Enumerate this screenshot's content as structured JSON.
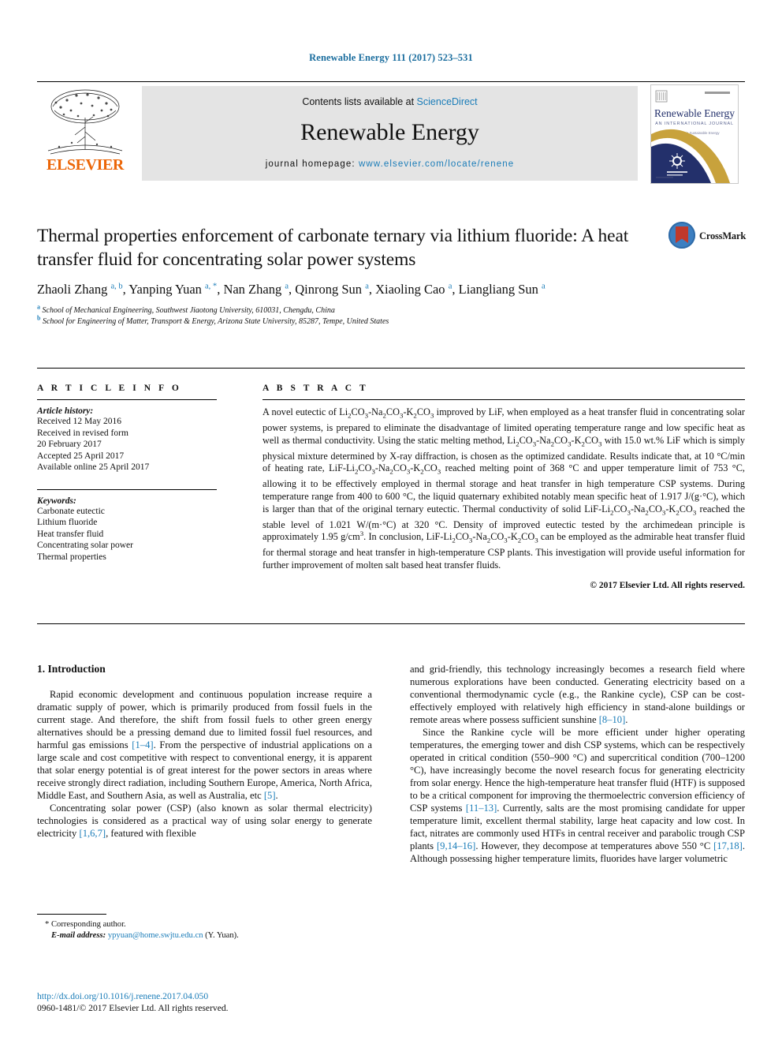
{
  "running_head": "Renewable Energy 111 (2017) 523–531",
  "masthead": {
    "contents_prefix": "Contents lists available at ",
    "sciencedirect": "ScienceDirect",
    "journal_title": "Renewable Energy",
    "homepage_label": "journal homepage: ",
    "homepage_url": "www.elsevier.com/locate/renene",
    "publisher_name": "ELSEVIER",
    "cover_title": "Renewable Energy",
    "cover_subtitle": "AN INTERNATIONAL JOURNAL",
    "cover_tagline": "Advances in Sustainable Energy"
  },
  "colors": {
    "link": "#1a7cb8",
    "running_head": "#1a6d9e",
    "elsevier_orange": "#ec6608",
    "masthead_bg": "#e4e4e4",
    "crossmark_blue": "#3c7fc1",
    "crossmark_red": "#c0392b",
    "cover_navy": "#23306b",
    "cover_gold": "#c8a23c"
  },
  "article": {
    "title": "Thermal properties enforcement of carbonate ternary via lithium fluoride: A heat transfer fluid for concentrating solar power systems",
    "authors_html": "Zhaoli Zhang <sup>a, b</sup>, Yanping Yuan <sup>a, *</sup>, Nan Zhang <sup>a</sup>, Qinrong Sun <sup>a</sup>, Xiaoling Cao <sup>a</sup>, Liangliang Sun <sup>a</sup>",
    "affiliation_a": "School of Mechanical Engineering, Southwest Jiaotong University, 610031, Chengdu, China",
    "affiliation_b": "School for Engineering of Matter, Transport & Energy, Arizona State University, 85287, Tempe, United States",
    "crossmark_label": "CrossMark"
  },
  "article_info": {
    "heading": "A R T I C L E   I N F O",
    "history_label": "Article history:",
    "history": [
      "Received 12 May 2016",
      "Received in revised form",
      "20 February 2017",
      "Accepted 25 April 2017",
      "Available online 25 April 2017"
    ],
    "keywords_label": "Keywords:",
    "keywords": [
      "Carbonate eutectic",
      "Lithium fluoride",
      "Heat transfer fluid",
      "Concentrating solar power",
      "Thermal properties"
    ]
  },
  "abstract": {
    "heading": "A B S T R A C T",
    "body_html": "A novel eutectic of Li<sub>2</sub>CO<sub>3</sub>-Na<sub>2</sub>CO<sub>3</sub>-K<sub>2</sub>CO<sub>3</sub> improved by LiF, when employed as a heat transfer fluid in concentrating solar power systems, is prepared to eliminate the disadvantage of limited operating temperature range and low specific heat as well as thermal conductivity. Using the static melting method, Li<sub>2</sub>CO<sub>3</sub>-Na<sub>2</sub>CO<sub>3</sub>-K<sub>2</sub>CO<sub>3</sub> with 15.0 wt.% LiF which is simply physical mixture determined by X-ray diffraction, is chosen as the optimized candidate. Results indicate that, at 10 °C/min of heating rate, LiF-Li<sub>2</sub>CO<sub>3</sub>-Na<sub>2</sub>CO<sub>3</sub>-K<sub>2</sub>CO<sub>3</sub> reached melting point of 368 °C and upper temperature limit of 753 °C, allowing it to be effectively employed in thermal storage and heat transfer in high temperature CSP systems. During temperature range from 400 to 600 °C, the liquid quaternary exhibited notably mean specific heat of 1.917 J/(g·°C), which is larger than that of the original ternary eutectic. Thermal conductivity of solid LiF-Li<sub>2</sub>CO<sub>3</sub>-Na<sub>2</sub>CO<sub>3</sub>-K<sub>2</sub>CO<sub>3</sub> reached the stable level of 1.021 W/(m·°C) at 320 °C. Density of improved eutectic tested by the archimedean principle is approximately 1.95 g/cm<sup class=\"num\">3</sup>. In conclusion, LiF-Li<sub>2</sub>CO<sub>3</sub>-Na<sub>2</sub>CO<sub>3</sub>-K<sub>2</sub>CO<sub>3</sub> can be employed as the admirable heat transfer fluid for thermal storage and heat transfer in high-temperature CSP plants. This investigation will provide useful information for further improvement of molten salt based heat transfer fluids.",
    "copyright": "© 2017 Elsevier Ltd. All rights reserved."
  },
  "introduction": {
    "heading": "1. Introduction",
    "left_paragraphs_html": [
      "Rapid economic development and continuous population increase require a dramatic supply of power, which is primarily produced from fossil fuels in the current stage. And therefore, the shift from fossil fuels to other green energy alternatives should be a pressing demand due to limited fossil fuel resources, and harmful gas emissions <span class=\"ref\">[1–4]</span>. From the perspective of industrial applications on a large scale and cost competitive with respect to conventional energy, it is apparent that solar energy potential is of great interest for the power sectors in areas where receive strongly direct radiation, including Southern Europe, America, North Africa, Middle East, and Southern Asia, as well as Australia, etc <span class=\"ref\">[5]</span>.",
      "Concentrating solar power (CSP) (also known as solar thermal electricity) technologies is considered as a practical way of using solar energy to generate electricity <span class=\"ref\">[1,6,7]</span>, featured with flexible"
    ],
    "right_paragraphs_html": [
      "and grid-friendly, this technology increasingly becomes a research field where numerous explorations have been conducted. Generating electricity based on a conventional thermodynamic cycle (e.g., the Rankine cycle), CSP can be cost-effectively employed with relatively high efficiency in stand-alone buildings or remote areas where possess sufficient sunshine <span class=\"ref\">[8–10]</span>.",
      "Since the Rankine cycle will be more efficient under higher operating temperatures, the emerging tower and dish CSP systems, which can be respectively operated in critical condition (550–900 °C) and supercritical condition (700–1200 °C), have increasingly become the novel research focus for generating electricity from solar energy. Hence the high-temperature heat transfer fluid (HTF) is supposed to be a critical component for improving the thermoelectric conversion efficiency of CSP systems <span class=\"ref\">[11–13]</span>. Currently, salts are the most promising candidate for upper temperature limit, excellent thermal stability, large heat capacity and low cost. In fact, nitrates are commonly used HTFs in central receiver and parabolic trough CSP plants <span class=\"ref\">[9,14–16]</span>. However, they decompose at temperatures above 550 °C <span class=\"ref\">[17,18]</span>. Although possessing higher temperature limits, fluorides have larger volumetric"
    ]
  },
  "footer": {
    "corresponding_marker": "*",
    "corresponding_label": "Corresponding author.",
    "email_label": "E-mail address:",
    "email": "ypyuan@home.swjtu.edu.cn",
    "email_suffix": "(Y. Yuan).",
    "doi": "http://dx.doi.org/10.1016/j.renene.2017.04.050",
    "issn_line": "0960-1481/© 2017 Elsevier Ltd. All rights reserved."
  }
}
